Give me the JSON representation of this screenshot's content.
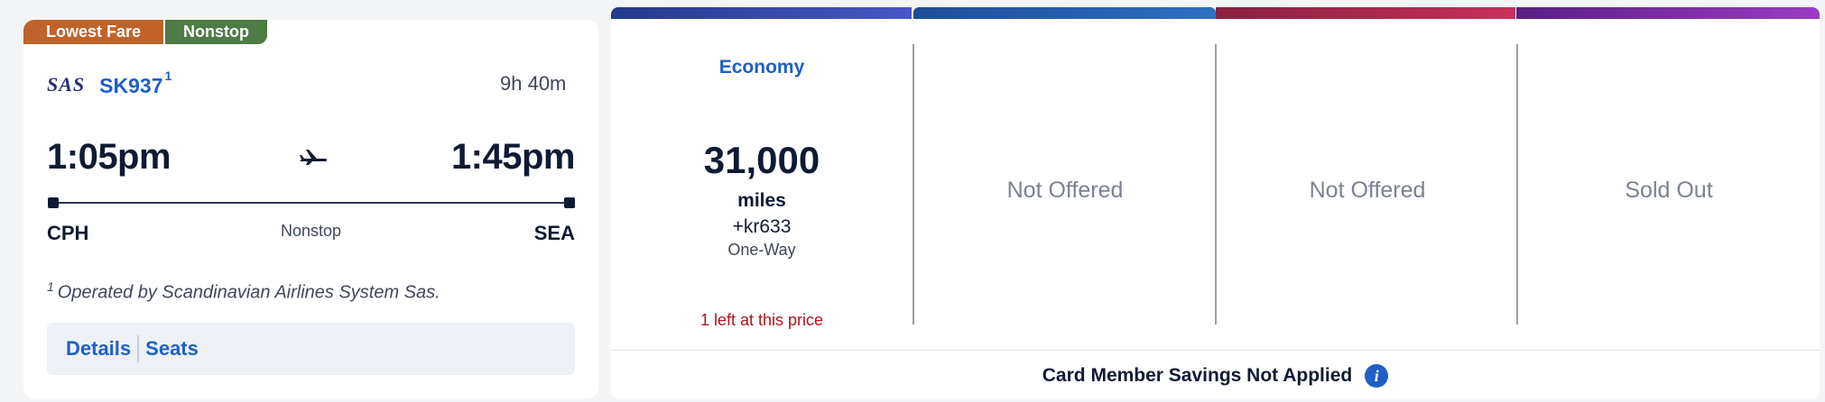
{
  "badges": [
    {
      "label": "Lowest Fare",
      "color": "#c0632b"
    },
    {
      "label": "Nonstop",
      "color": "#4f7b44"
    }
  ],
  "flight": {
    "airline_logo": "SAS",
    "flight_number": "SK937",
    "footnote_marker": "1",
    "duration": "9h 40m",
    "departure_time": "1:05pm",
    "arrival_time": "1:45pm",
    "origin": "CPH",
    "destination": "SEA",
    "stops": "Nonstop",
    "operated_by": "Operated by Scandinavian Airlines System Sas.",
    "plane_icon": "airplane-icon"
  },
  "links": {
    "details": "Details",
    "seats": "Seats"
  },
  "fares": [
    {
      "cabin": "Economy",
      "miles": "31,000",
      "miles_unit": "miles",
      "price": "+kr633",
      "trip_type": "One-Way",
      "availability_note": "1 left at this price",
      "strip_colors": [
        "#243a8a",
        "#4a55c8"
      ]
    },
    {
      "status": "Not Offered",
      "strip_colors": [
        "#1f4d96",
        "#2e6fc4"
      ]
    },
    {
      "status": "Not Offered",
      "strip_colors": [
        "#8a1f3f",
        "#c9315c"
      ]
    },
    {
      "status": "Sold Out",
      "strip_colors": [
        "#5a1f82",
        "#9b3cc4"
      ]
    }
  ],
  "footer": {
    "text": "Card Member Savings Not Applied",
    "info_icon": "info-icon"
  },
  "colors": {
    "accent": "#1f5fc7",
    "alert": "#b3121a"
  }
}
